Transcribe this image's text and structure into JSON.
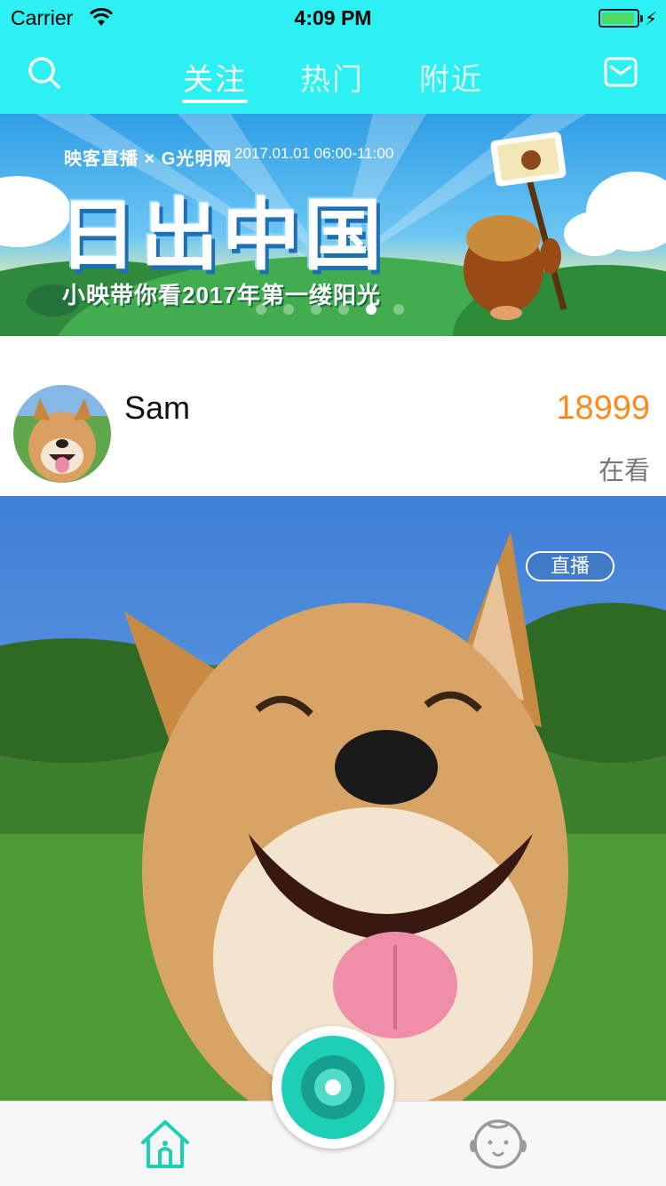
{
  "status_bar": {
    "carrier": "Carrier",
    "time": "4:09 PM",
    "battery_level": 0.95
  },
  "nav": {
    "tabs": [
      {
        "label": "关注",
        "active": true
      },
      {
        "label": "热门",
        "active": false
      },
      {
        "label": "附近",
        "active": false
      }
    ],
    "left_icon": "search-icon",
    "right_icon": "mail-icon"
  },
  "banner": {
    "brand": "映客直播 × G光明网",
    "date": "2017.01.01 06:00-11:00",
    "title": "日出中国",
    "subtitle": "小映带你看2017年第一缕阳光",
    "page_count": 6,
    "active_page": 4
  },
  "live_card": {
    "username": "Sam",
    "viewer_count": "18999",
    "viewer_label": "在看",
    "badge": "直播"
  },
  "tabbar": {
    "items": [
      "home-icon",
      "record-icon",
      "profile-icon"
    ]
  },
  "colors": {
    "nav_bg": "#2df0f2",
    "accent_teal": "#1ccfb5",
    "viewer_orange": "#ff8a1c"
  }
}
